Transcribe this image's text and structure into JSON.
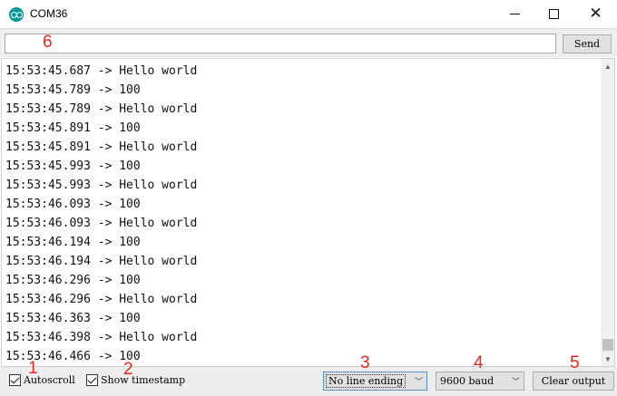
{
  "window": {
    "title": "COM36",
    "minimize_glyph": "",
    "close_glyph": "✕"
  },
  "send_bar": {
    "input_value": "",
    "send_label": "Send"
  },
  "output": {
    "lines": [
      "15:53:45.687 -> Hello world",
      "15:53:45.789 -> 100",
      "15:53:45.789 -> Hello world",
      "15:53:45.891 -> 100",
      "15:53:45.891 -> Hello world",
      "15:53:45.993 -> 100",
      "15:53:45.993 -> Hello world",
      "15:53:46.093 -> 100",
      "15:53:46.093 -> Hello world",
      "15:53:46.194 -> 100",
      "15:53:46.194 -> Hello world",
      "15:53:46.296 -> 100",
      "15:53:46.296 -> Hello world",
      "15:53:46.363 -> 100",
      "15:53:46.398 -> Hello world",
      "15:53:46.466 -> 100"
    ]
  },
  "bottom_bar": {
    "autoscroll_label": "Autoscroll",
    "autoscroll_checked": true,
    "timestamp_label": "Show timestamp",
    "timestamp_checked": true,
    "line_ending_value": "No line ending",
    "baud_value": "9600 baud",
    "clear_label": "Clear output"
  },
  "annotations": {
    "a1": "1",
    "a2": "2",
    "a3": "3",
    "a4": "4",
    "a5": "5",
    "a6": "6"
  },
  "colors": {
    "annotation": "#e8261c",
    "arduino_teal": "#00979c"
  }
}
